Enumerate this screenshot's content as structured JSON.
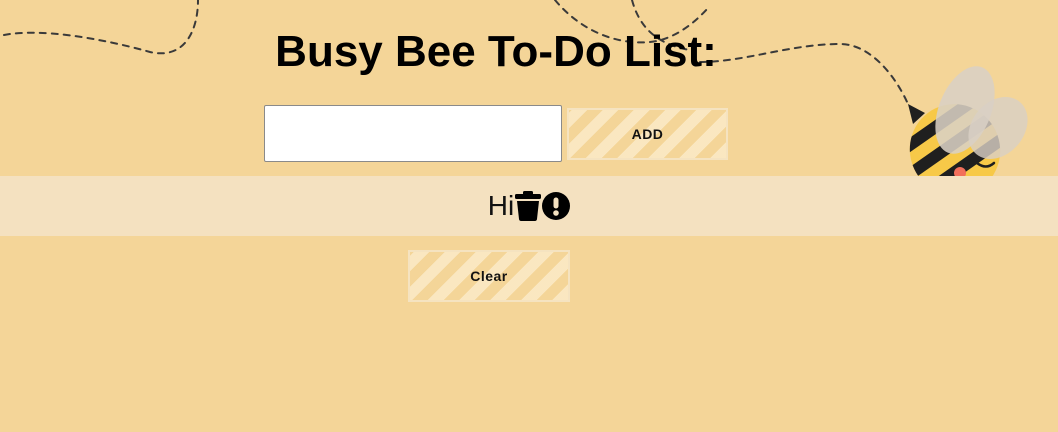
{
  "app": {
    "title": "Busy Bee To-Do List:"
  },
  "form": {
    "input_value": "",
    "input_placeholder": "",
    "add_label": "ADD"
  },
  "tasks": [
    {
      "text": "Hi",
      "delete_icon": "trash-icon",
      "important_icon": "exclamation-circle-icon"
    }
  ],
  "actions": {
    "clear_label": "Clear"
  },
  "colors": {
    "background": "#f4d598",
    "task_row": "#f4e1c0",
    "button_stripe": "#fff6e2",
    "bee_yellow": "#f7c948",
    "bee_stripe": "#1f1f1f"
  },
  "decorations": {
    "bee": "bee-illustration",
    "flight_path": "dashed-flight-path"
  }
}
